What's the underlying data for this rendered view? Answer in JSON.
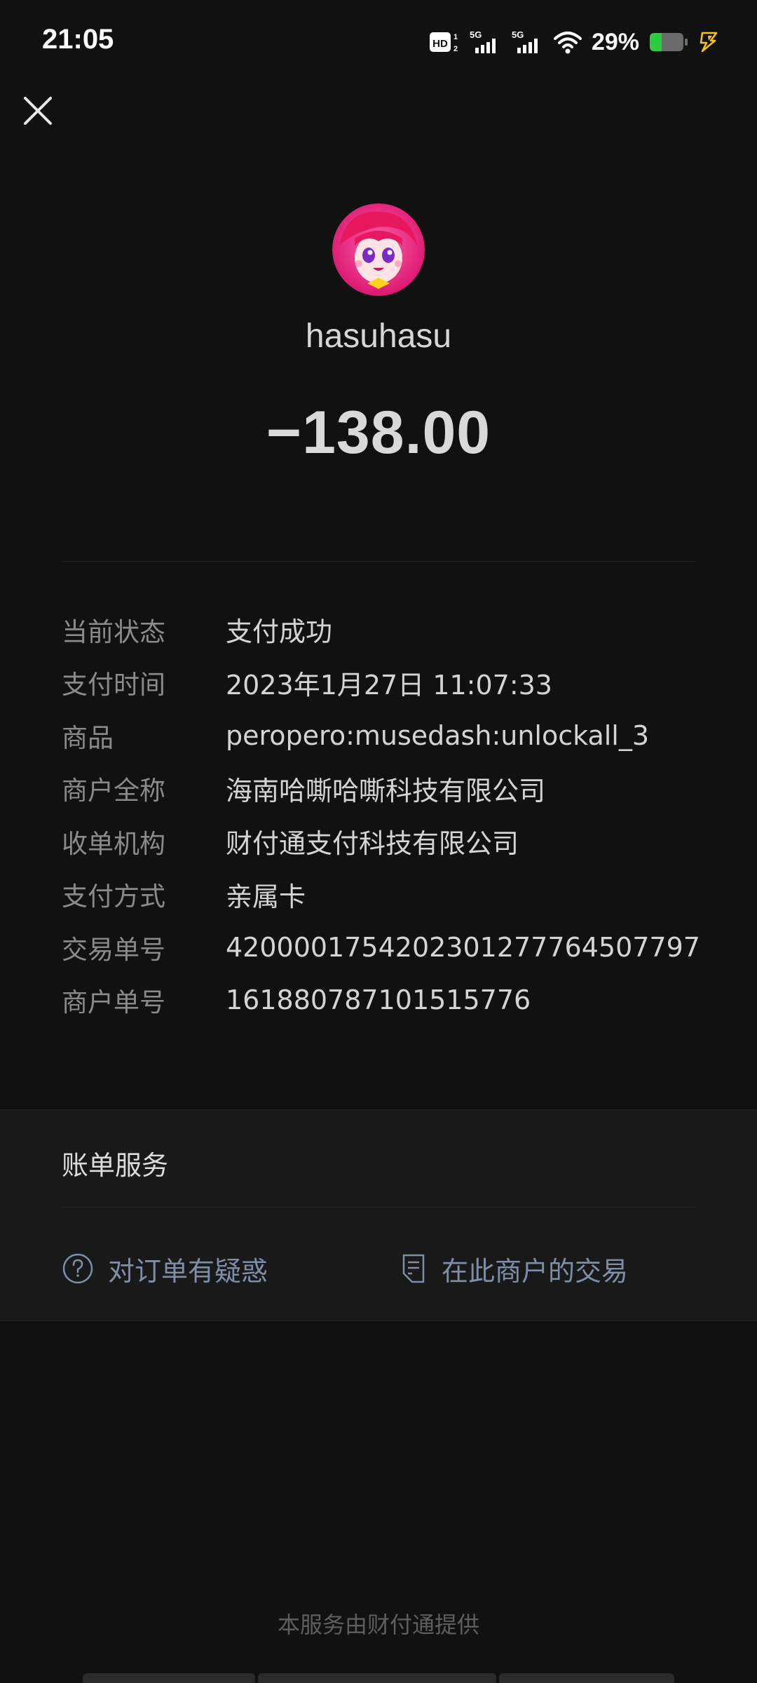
{
  "status_bar": {
    "time": "21:05",
    "hd_label": "HD",
    "signal_1_label": "5G",
    "signal_2_label": "5G",
    "battery_percent": "29%",
    "icons": [
      "hd-icon",
      "signal-5g-icon",
      "signal-5g-icon",
      "wifi-icon",
      "battery-icon",
      "charging-icon"
    ],
    "battery_color": "#2ecc40",
    "charging_color": "#f5c518"
  },
  "header": {
    "merchant_name": "hasuhasu",
    "amount": "−138.00"
  },
  "details": {
    "rows": [
      {
        "label": "当前状态",
        "value": "支付成功"
      },
      {
        "label": "支付时间",
        "value": "2023年1月27日 11:07:33"
      },
      {
        "label": "商品",
        "value": "peropero:musedash:unlockall_3"
      },
      {
        "label": "商户全称",
        "value": "海南哈嘶哈嘶科技有限公司"
      },
      {
        "label": "收单机构",
        "value": "财付通支付科技有限公司"
      },
      {
        "label": "支付方式",
        "value": "亲属卡"
      },
      {
        "label": "交易单号",
        "value": "4200001754202301277764507797"
      },
      {
        "label": "商户单号",
        "value": "161880787101515776"
      }
    ]
  },
  "service": {
    "title": "账单服务",
    "links": [
      {
        "label": "对订单有疑惑",
        "icon": "question-circle-icon"
      },
      {
        "label": "在此商户的交易",
        "icon": "document-icon"
      }
    ],
    "link_color": "#7e8ea7"
  },
  "footer": {
    "text": "本服务由财付通提供"
  }
}
